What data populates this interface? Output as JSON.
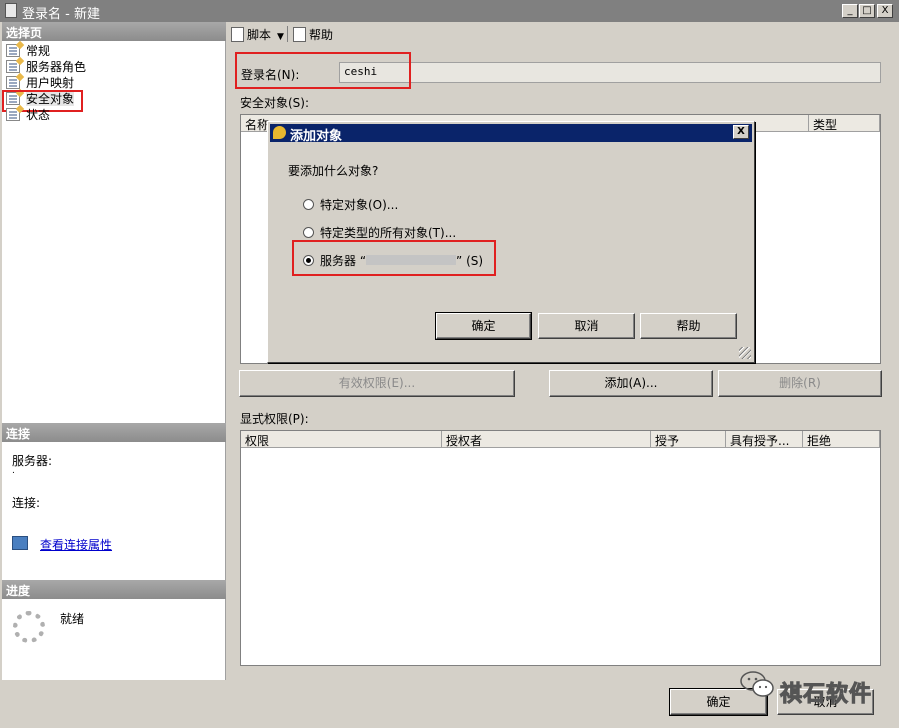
{
  "window": {
    "title": "登录名 - 新建",
    "min_label": "_",
    "max_label": "□",
    "close_label": "X"
  },
  "left": {
    "select_page_header": "选择页",
    "pages": [
      {
        "label": "常规"
      },
      {
        "label": "服务器角色"
      },
      {
        "label": "用户映射"
      },
      {
        "label": "安全对象"
      },
      {
        "label": "状态"
      }
    ],
    "connection_header": "连接",
    "server_label": "服务器:",
    "server_value": ".",
    "connection_label": "连接:",
    "view_props_link": "查看连接属性",
    "progress_header": "进度",
    "progress_status": "就绪"
  },
  "toolbar": {
    "script_label": "脚本",
    "help_label": "帮助"
  },
  "main": {
    "login_name_label": "登录名(N):",
    "login_name_value": "ceshi",
    "securables_label": "安全对象(S):",
    "securables_columns": [
      "名称",
      "类型"
    ],
    "buttons": {
      "effective": "有效权限(E)...",
      "add": "添加(A)...",
      "remove": "删除(R)"
    },
    "explicit_label": "显式权限(P):",
    "explicit_columns": [
      "权限",
      "授权者",
      "授予",
      "具有授予...",
      "拒绝"
    ],
    "ok_label": "确定",
    "cancel_label": "取消"
  },
  "dialog": {
    "title": "添加对象",
    "close_label": "X",
    "question": "要添加什么对象?",
    "options": [
      {
        "label": "特定对象(O)...",
        "selected": false
      },
      {
        "label": "特定类型的所有对象(T)...",
        "selected": false
      },
      {
        "label_prefix": "服务器 “",
        "label_suffix": "” (S)",
        "selected": true
      }
    ],
    "ok_label": "确定",
    "cancel_label": "取消",
    "help_label": "帮助"
  },
  "watermark": {
    "text": "祺石软件"
  },
  "colors": {
    "highlight_border": "#e02020",
    "dialog_title_bg": "#0a246a",
    "link": "#0000cc"
  }
}
